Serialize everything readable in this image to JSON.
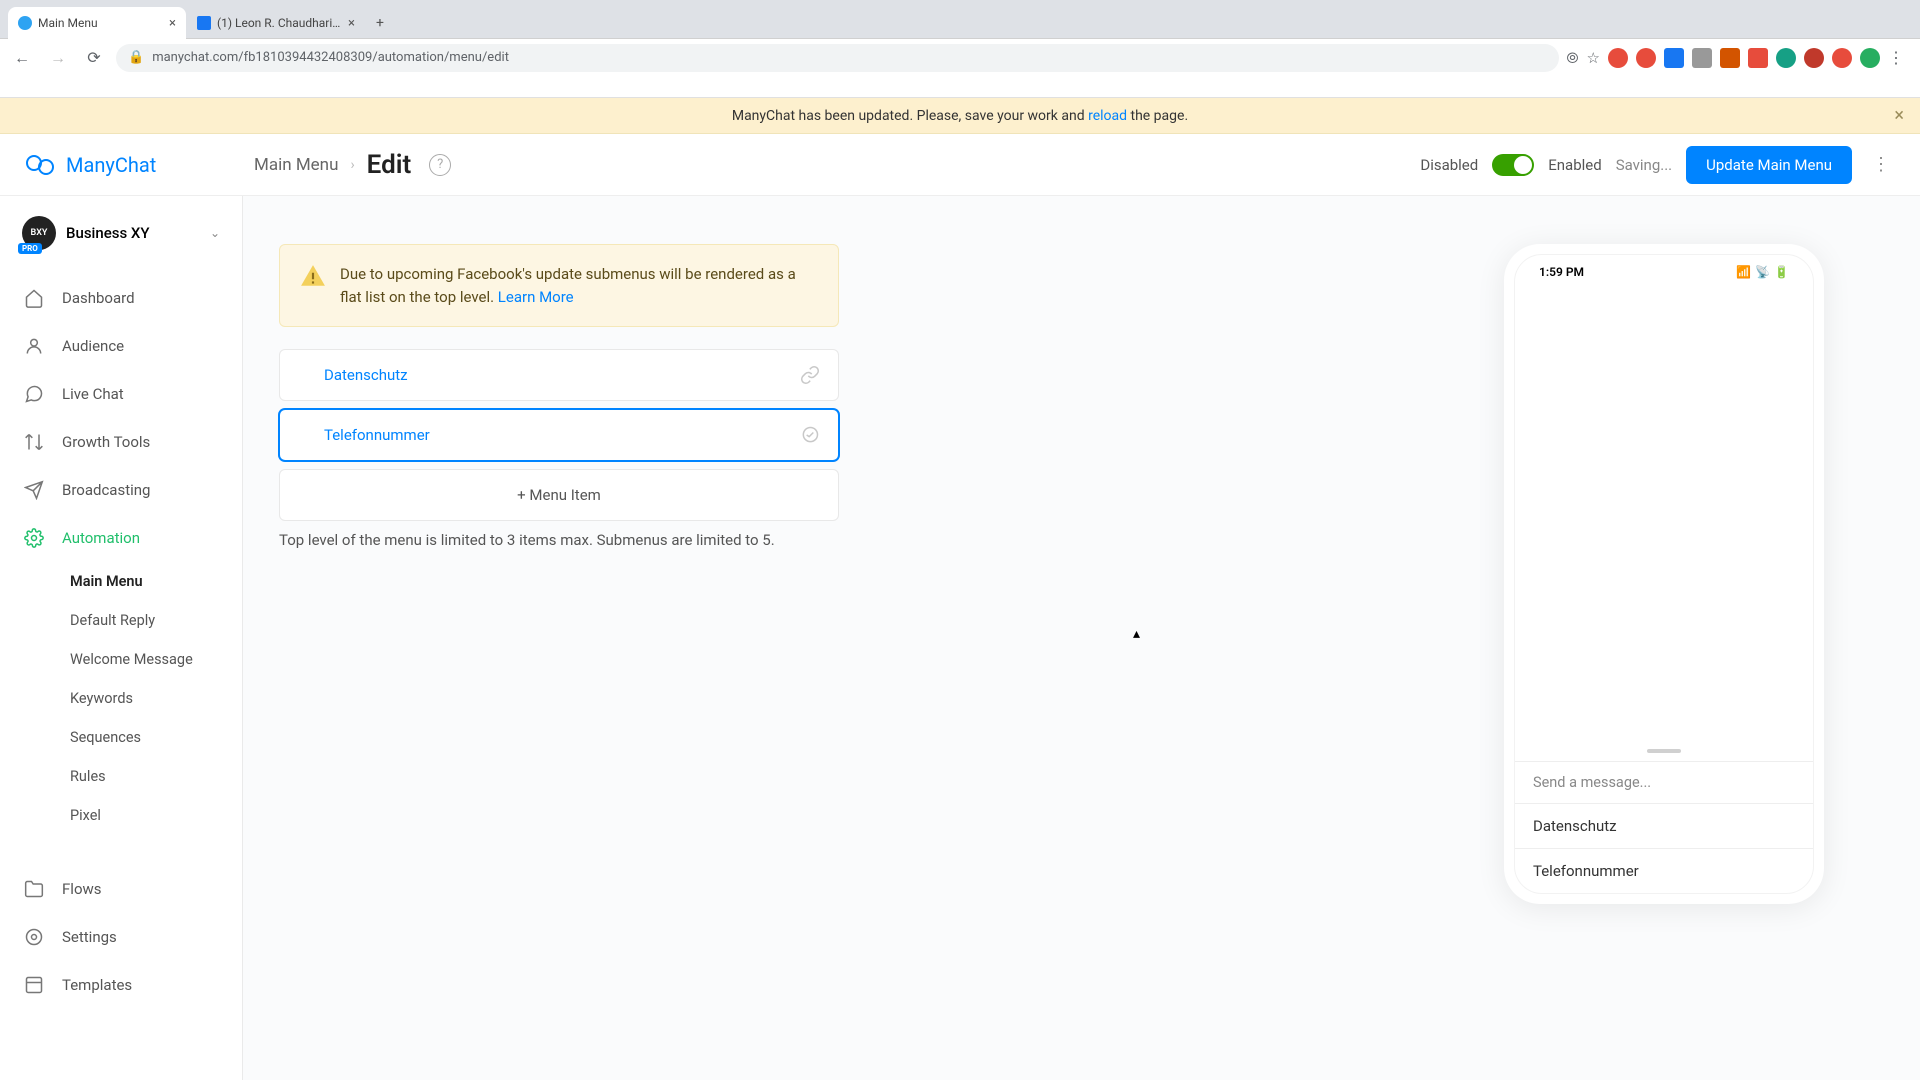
{
  "browser": {
    "tabs": [
      {
        "label": "Main Menu",
        "active": true,
        "fav": "mc"
      },
      {
        "label": "(1) Leon R. Chaudhari | Facebo",
        "active": false,
        "fav": "fb"
      }
    ],
    "url": "manychat.com/fb1810394432408309/automation/menu/edit"
  },
  "notif": {
    "prefix": "ManyChat has been updated. Please, save your work and ",
    "link": "reload",
    "suffix": " the page."
  },
  "brand": "ManyChat",
  "workspace": {
    "name": "Business XY",
    "badge": "PRO"
  },
  "sidebar": {
    "items": [
      {
        "label": "Dashboard"
      },
      {
        "label": "Audience"
      },
      {
        "label": "Live Chat"
      },
      {
        "label": "Growth Tools"
      },
      {
        "label": "Broadcasting"
      },
      {
        "label": "Automation",
        "active": true
      },
      {
        "label": "Flows"
      },
      {
        "label": "Settings"
      },
      {
        "label": "Templates"
      }
    ],
    "sub": [
      {
        "label": "Main Menu",
        "active": true
      },
      {
        "label": "Default Reply"
      },
      {
        "label": "Welcome Message"
      },
      {
        "label": "Keywords"
      },
      {
        "label": "Sequences"
      },
      {
        "label": "Rules"
      },
      {
        "label": "Pixel"
      }
    ]
  },
  "header": {
    "crumb": "Main Menu",
    "title": "Edit",
    "disabled": "Disabled",
    "enabled": "Enabled",
    "saving": "Saving...",
    "update_btn": "Update Main Menu"
  },
  "warning": {
    "text": "Due to upcoming Facebook's update submenus will be rendered as a flat list on the top level. ",
    "link": "Learn More"
  },
  "menu_items": [
    {
      "label": "Datenschutz",
      "type": "link"
    },
    {
      "label": "Telefonnummer",
      "type": "reply"
    }
  ],
  "add_item": "+ Menu Item",
  "limit_text": "Top level of the menu is limited to 3 items max. Submenus are limited to 5.",
  "phone": {
    "time": "1:59 PM",
    "send_placeholder": "Send a message...",
    "items": [
      "Datenschutz",
      "Telefonnummer"
    ]
  }
}
